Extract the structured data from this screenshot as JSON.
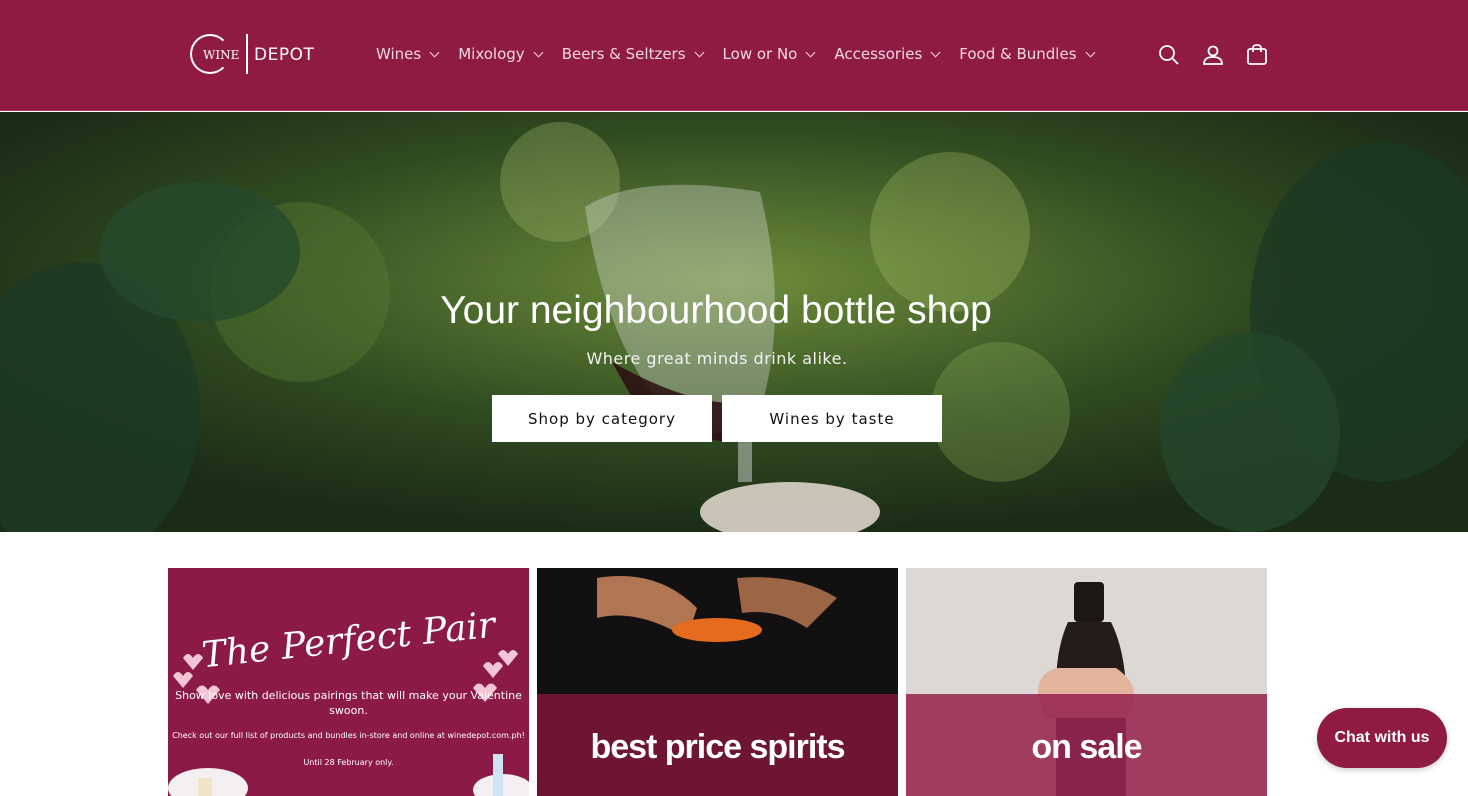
{
  "brand": {
    "logo_wine": "WINE",
    "logo_depot": "DEPOT",
    "color": "#8f1b45"
  },
  "nav": {
    "items": [
      {
        "label": "Wines"
      },
      {
        "label": "Mixology"
      },
      {
        "label": "Beers & Seltzers"
      },
      {
        "label": "Low or No"
      },
      {
        "label": "Accessories"
      },
      {
        "label": "Food & Bundles"
      }
    ],
    "icons": [
      "search-icon",
      "account-icon",
      "cart-icon"
    ]
  },
  "hero": {
    "title": "Your neighbourhood bottle shop",
    "subtitle": "Where great minds drink alike.",
    "button_1": "Shop by category",
    "button_2": "Wines by taste"
  },
  "tiles": {
    "perfect_pair": {
      "title": "The Perfect Pair",
      "text": "Show love with delicious pairings that will make your Valentine swoon.",
      "small": "Check out our full list of products and bundles in-store and online at winedepot.com.ph!",
      "until": "Until 28 February only."
    },
    "spirits": {
      "label": "best price spirits"
    },
    "sale": {
      "label": "on sale"
    }
  },
  "chat": {
    "label": "Chat with us"
  }
}
